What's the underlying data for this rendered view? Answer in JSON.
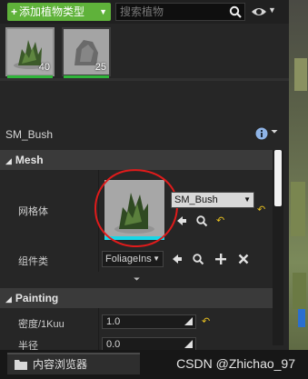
{
  "toolbar": {
    "add_button_label": "添加植物类型",
    "search_placeholder": "搜索植物"
  },
  "palette": [
    {
      "name": "bush",
      "count": "40"
    },
    {
      "name": "rock",
      "count": "25"
    }
  ],
  "details": {
    "object_name": "SM_Bush",
    "mesh_section": {
      "header": "Mesh",
      "mesh_label": "网格体",
      "mesh_value": "SM_Bush",
      "component_label": "组件类",
      "component_value": "FoliageIns"
    },
    "painting_section": {
      "header": "Painting",
      "density_label": "密度/1Kuu",
      "density_value": "1.0",
      "radius_label": "半径",
      "radius_value": "0.0"
    }
  },
  "bottom": {
    "tab_label": "内容浏览器",
    "watermark": "CSDN @Zhichao_97"
  },
  "colors": {
    "accent_green": "#5fb23a",
    "annotation_red": "#e01b1b",
    "reset_yellow": "#e8c020"
  }
}
